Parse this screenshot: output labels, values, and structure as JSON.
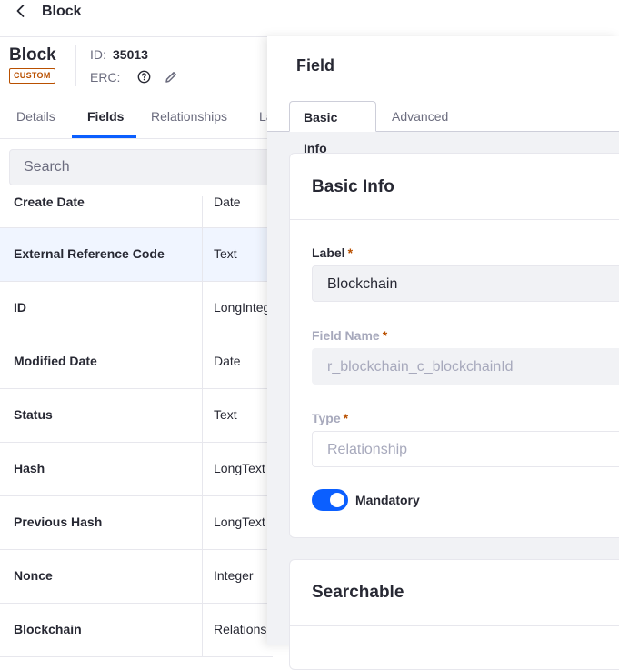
{
  "topbar": {
    "title": "Block"
  },
  "object": {
    "name": "Block",
    "badge": "CUSTOM",
    "id_label": "ID:",
    "id_value": "35013",
    "erc_label": "ERC:"
  },
  "left_tabs": [
    {
      "label": "Details"
    },
    {
      "label": "Fields"
    },
    {
      "label": "Relationships"
    },
    {
      "label": "La"
    }
  ],
  "search": {
    "placeholder": "Search"
  },
  "fields": [
    {
      "name": "Create Date",
      "type": "Date"
    },
    {
      "name": "External Reference Code",
      "type": "Text"
    },
    {
      "name": "ID",
      "type": "LongInteger"
    },
    {
      "name": "Modified Date",
      "type": "Date"
    },
    {
      "name": "Status",
      "type": "Text"
    },
    {
      "name": "Hash",
      "type": "LongText"
    },
    {
      "name": "Previous Hash",
      "type": "LongText"
    },
    {
      "name": "Nonce",
      "type": "Integer"
    },
    {
      "name": "Blockchain",
      "type": "Relationship"
    }
  ],
  "panel": {
    "title": "Field",
    "tabs": [
      {
        "label": "Basic Info"
      },
      {
        "label": "Advanced"
      }
    ],
    "basic_info": {
      "title": "Basic Info",
      "label_field": {
        "label": "Label",
        "required": "*",
        "value": "Blockchain"
      },
      "field_name": {
        "label": "Field Name",
        "required": "*",
        "value": "r_blockchain_c_blockchainId"
      },
      "type_field": {
        "label": "Type",
        "required": "*",
        "value": "Relationship"
      },
      "mandatory": {
        "label": "Mandatory",
        "checked": true
      }
    },
    "searchable": {
      "title": "Searchable"
    }
  },
  "colors": {
    "accent": "#0b5fff",
    "badge": "#b95000",
    "selected_row": "#f0f5ff",
    "panel_bg": "#f1f2f5"
  }
}
